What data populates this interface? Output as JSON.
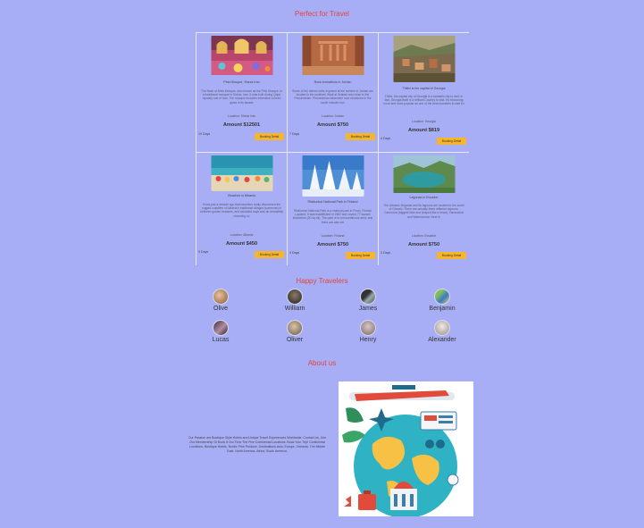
{
  "titles": {
    "travel": "Perfect for Travel",
    "travelers": "Happy Travelers",
    "about": "About us"
  },
  "cards": [
    {
      "image": "mosque-interior-image",
      "title": "Pink Mosque, Shiraz Iran",
      "desc": "The Nasir al-Molk Mosque, also known as the Pink Mosque, is a traditional mosque in Shiraz, Iran. It was built during Qajar dynasty rule of Iran. The mosque includes extensive colored glass in its facade",
      "location": "Location: Shiraz Iran",
      "amount": "Amount $12501",
      "days": "10 Days",
      "button": "Booking Detail"
    },
    {
      "image": "petra-image",
      "title": "Rock formations in Jordan",
      "desc": "Some of the oldest rocks exposed at the surface in Jordan are located in the southern Wadi al 'Arabah and close to the Precambrian. Precambrian basement rock structures in the south include rock",
      "location": "Location: Jordan",
      "amount": "Amount $750",
      "days": "7 Days",
      "button": "Booking Detail"
    },
    {
      "image": "tbilisi-image",
      "title": "Tbilisi is the capital of Georgia",
      "desc": "Tbilisi, the capital city of Georgia is a fantastic city to visit. In fact, Georgia itself is a brilliant Country to visit. It's becoming more and more popular as one of the best countries to visit for",
      "location": "Location: Georgia",
      "amount": "Amount $819",
      "days": "4 Days",
      "button": "Booking Detail"
    },
    {
      "image": "beach-image",
      "title": "Beaches in Albania",
      "desc": "It was just a decade ago that travellers really discovered the rugged coastline of Albania's traditional villages (someone) in between golden beaches, and secluded bays was an irresistibly charming co",
      "location": "Location: Albania",
      "amount": "Amount $450",
      "days": "5 Days",
      "button": "Booking Detail"
    },
    {
      "image": "snow-forest-image",
      "title": "Riisitunturi National Park in Finland",
      "desc": "Riisitunturi National Park is a national park in Posio, Finnish Lapland. It was established in 1982 and covers 77 square kilometres (30 sq mi). The park is in a mountainous area, and there are also we",
      "location": "Location: Finland",
      "amount": "Amount $750",
      "days": "4 Days",
      "button": "Booking Detail"
    },
    {
      "image": "crater-lake-image",
      "title": "Lagunas in Ecuador",
      "desc": "The volcanic Mojanda and its lagoons are located to the south of Otavalo. There are actually three different lagoons: Caricocha (biggest lake and shaped like a heart), Yanacocha and Warmicocha. Next to",
      "location": "Location: Ecuador",
      "amount": "Amount $750",
      "days": "3 Days",
      "button": "Booking Detail"
    }
  ],
  "travelers": [
    {
      "name": "Olive",
      "avatar": "avatar-olive"
    },
    {
      "name": "William",
      "avatar": "avatar-william"
    },
    {
      "name": "James",
      "avatar": "avatar-james"
    },
    {
      "name": "Benjamin",
      "avatar": "avatar-benjamin"
    },
    {
      "name": "Lucas",
      "avatar": "avatar-lucas"
    },
    {
      "name": "Oliver",
      "avatar": "avatar-oliver"
    },
    {
      "name": "Henry",
      "avatar": "avatar-henry"
    },
    {
      "name": "Alexander",
      "avatar": "avatar-alexander"
    }
  ],
  "about": {
    "text": "Our Passion are Boutique Style Hotels and Unique Travel Experiences Worldwide. Contact Us, Join Our Membership Or Book It Our Time The Five Continental Locations. Book Your Trip! Continental Locations. Boutique Hotels, Nordic Pine Produce, Destinations Asia, Europe, Oceania, The Middle East, North America, Africa, South America.",
    "image": "travel-illustration-image"
  },
  "colors": {
    "background": "#a7aef5",
    "heading": "#e3443c",
    "button": "#f7b52c"
  }
}
